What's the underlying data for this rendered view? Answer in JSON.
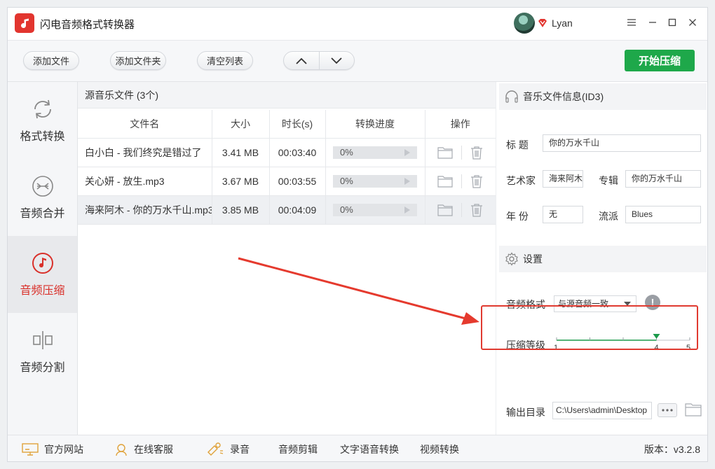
{
  "app": {
    "title": "闪电音频格式转换器"
  },
  "user": {
    "name": "Lyan"
  },
  "window_controls": {
    "menu": "☰",
    "minimize": "—",
    "maximize": "☐",
    "close": "✕"
  },
  "toolbar": {
    "add_file": "添加文件",
    "add_folder": "添加文件夹",
    "clear_list": "清空列表",
    "start": "开始压缩"
  },
  "sidebar": {
    "items": [
      {
        "label": "格式转换",
        "icon": "refresh-icon"
      },
      {
        "label": "音频合并",
        "icon": "merge-icon"
      },
      {
        "label": "音频压缩",
        "icon": "music-note-icon",
        "active": true
      },
      {
        "label": "音频分割",
        "icon": "split-icon"
      }
    ]
  },
  "file_list": {
    "title": "源音乐文件 (3个)",
    "columns": [
      "文件名",
      "大小",
      "时长(s)",
      "转换进度",
      "操作"
    ],
    "rows": [
      {
        "name": "白小白 - 我们终究是错过了",
        "size": "3.41 MB",
        "duration": "00:03:40",
        "progress": "0%"
      },
      {
        "name": "关心妍 - 放生.mp3",
        "size": "3.67 MB",
        "duration": "00:03:55",
        "progress": "0%"
      },
      {
        "name": "海来阿木 - 你的万水千山.mp3",
        "size": "3.85 MB",
        "duration": "00:04:09",
        "progress": "0%"
      }
    ]
  },
  "info": {
    "title": "音乐文件信息(ID3)",
    "labels": {
      "title": "标  题",
      "artist": "艺术家",
      "album": "专辑",
      "year": "年  份",
      "genre": "流派"
    },
    "values": {
      "title": "你的万水千山",
      "artist": "海来阿木",
      "album": "你的万水千山",
      "year": "无",
      "genre": "Blues"
    }
  },
  "settings": {
    "title": "设置",
    "format_label": "音频格式",
    "format_value": "与源音频一致",
    "level_label": "压缩等级",
    "level_min": "1",
    "level_value": "4",
    "level_max": "5",
    "level": 4,
    "output_label": "输出目录",
    "output_value": "C:\\Users\\admin\\Desktop"
  },
  "bottombar": {
    "website": "官方网站",
    "support": "在线客服",
    "record": "录音",
    "edit": "音频剪辑",
    "tts": "文字语音转换",
    "video": "视频转换",
    "version": "版本：v3.2.8"
  },
  "colors": {
    "accent_red": "#d9302a",
    "green": "#1ea84a",
    "highlight_box": "#e03a30"
  }
}
